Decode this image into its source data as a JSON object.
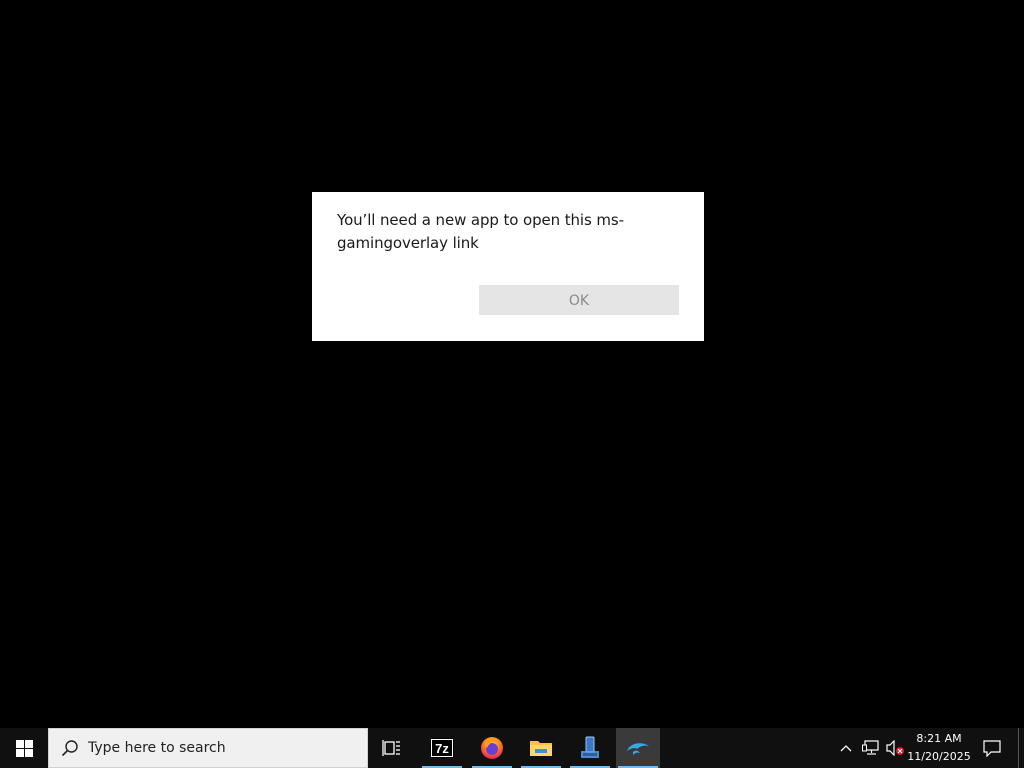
{
  "dialog": {
    "message": "You’ll need a new app to open this ms-gamingoverlay link",
    "ok_label": "OK"
  },
  "taskbar": {
    "search_placeholder": "Type here to search",
    "pinned_apps": [
      {
        "name": "Task View",
        "icon": "task-view-icon",
        "running": false
      },
      {
        "name": "7-Zip",
        "icon": "7zip-icon",
        "label": "7z",
        "running": true
      },
      {
        "name": "Firefox",
        "icon": "firefox-icon",
        "running": true
      },
      {
        "name": "File Explorer",
        "icon": "file-explorer-icon",
        "running": true
      },
      {
        "name": "Installer",
        "icon": "installer-icon",
        "running": true
      },
      {
        "name": "Dolphin",
        "icon": "dolphin-icon",
        "running": true,
        "active": true
      }
    ],
    "tray": {
      "time": "8:21 AM",
      "date": "11/20/2025",
      "icons": [
        "chevron-up-icon",
        "network-icon",
        "volume-muted-icon",
        "notifications-icon"
      ]
    }
  },
  "colors": {
    "accent": "#76b9ed",
    "taskbar_bg": "#101010",
    "desktop_bg": "#000000"
  }
}
